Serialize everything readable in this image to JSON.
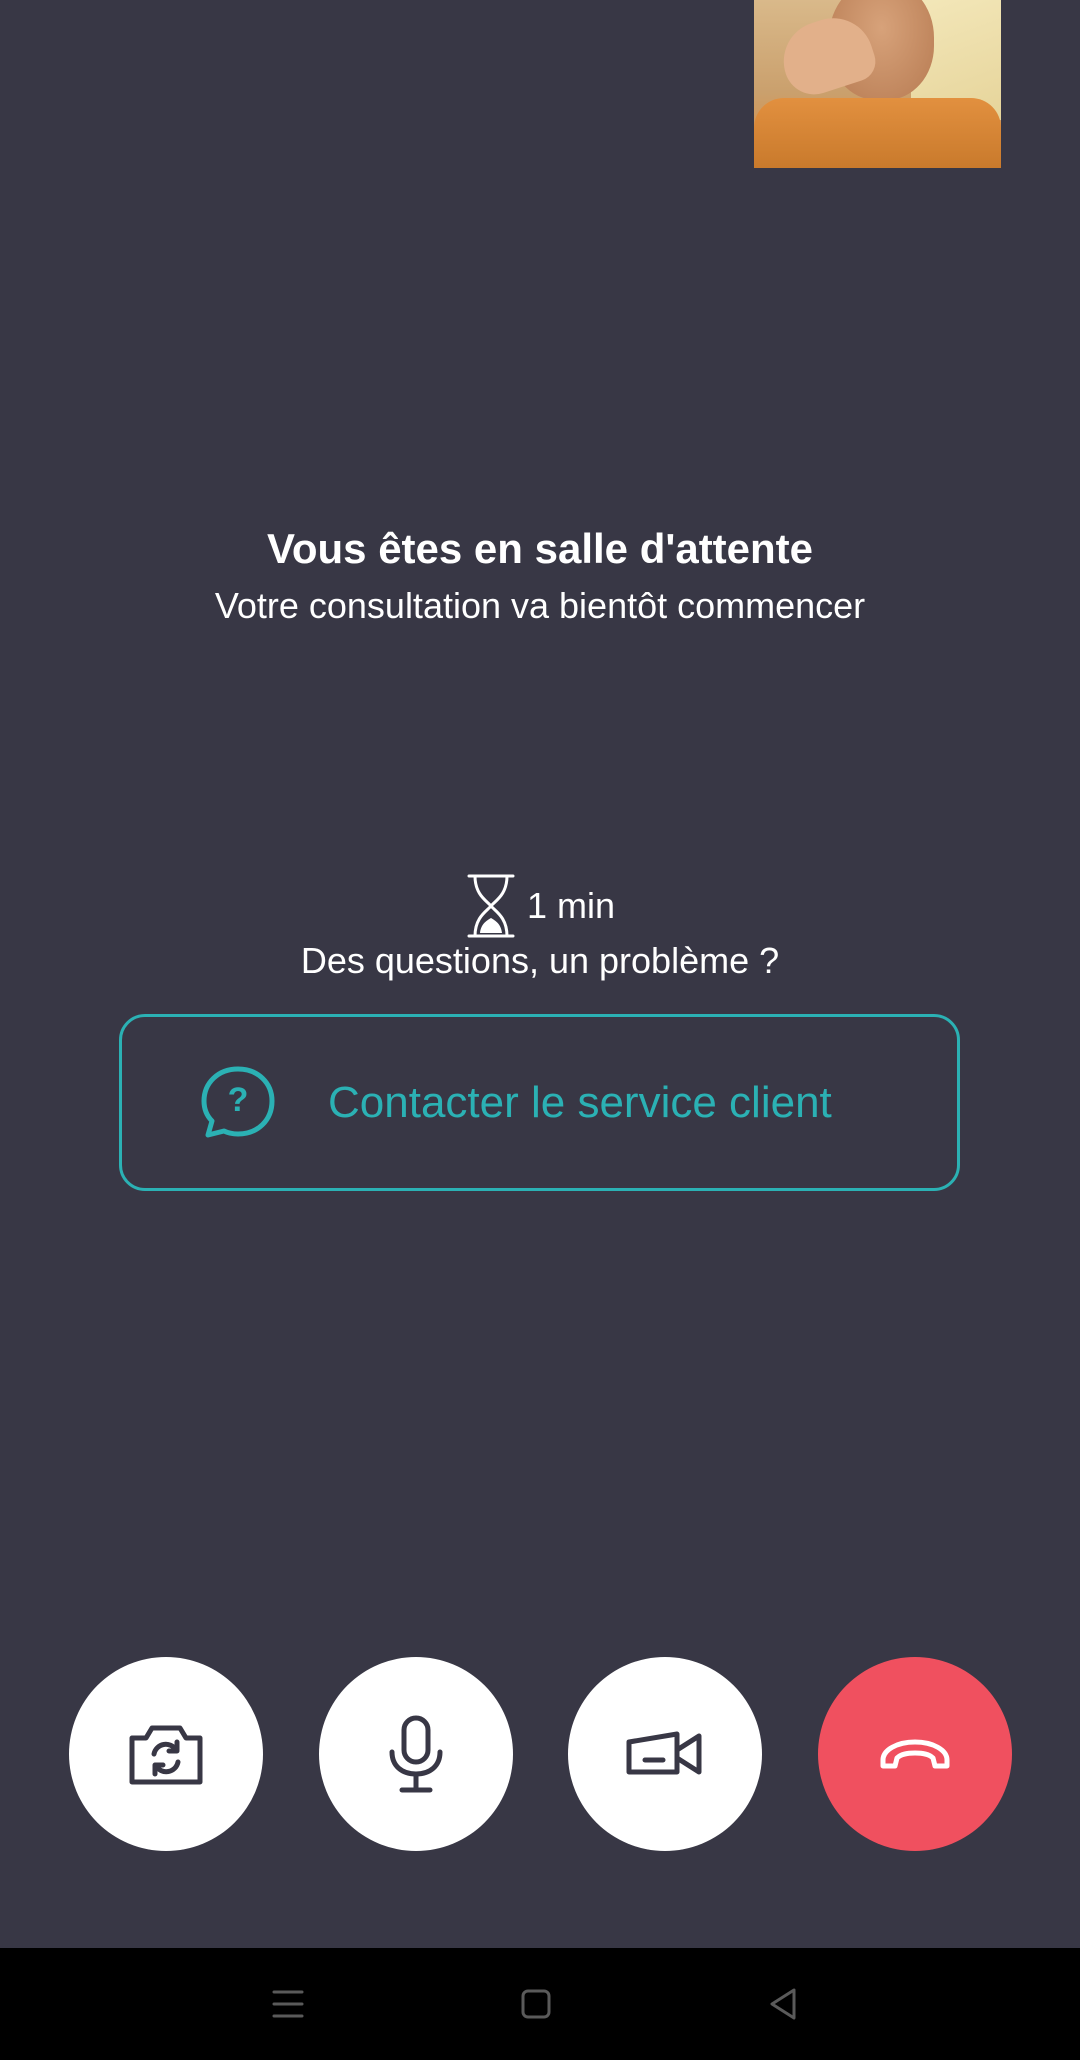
{
  "call": {
    "self_view_alt": "self-view-camera",
    "title": "Vous êtes en salle d'attente",
    "subtitle": "Votre consultation va bientôt commencer",
    "wait_time": "1 min",
    "question": "Des questions, un problème ?",
    "contact_label": "Contacter le service client"
  },
  "controls": {
    "switch_camera_icon": "camera-switch-icon",
    "mic_icon": "microphone-icon",
    "video_icon": "video-camera-icon",
    "hangup_icon": "phone-hangup-icon"
  },
  "navbar": {
    "menu_icon": "menu-icon",
    "home_icon": "home-square-icon",
    "back_icon": "back-triangle-icon"
  },
  "colors": {
    "background": "#383745",
    "accent": "#2bb1b4",
    "hangup": "#f0505f",
    "navbar": "#000000"
  }
}
